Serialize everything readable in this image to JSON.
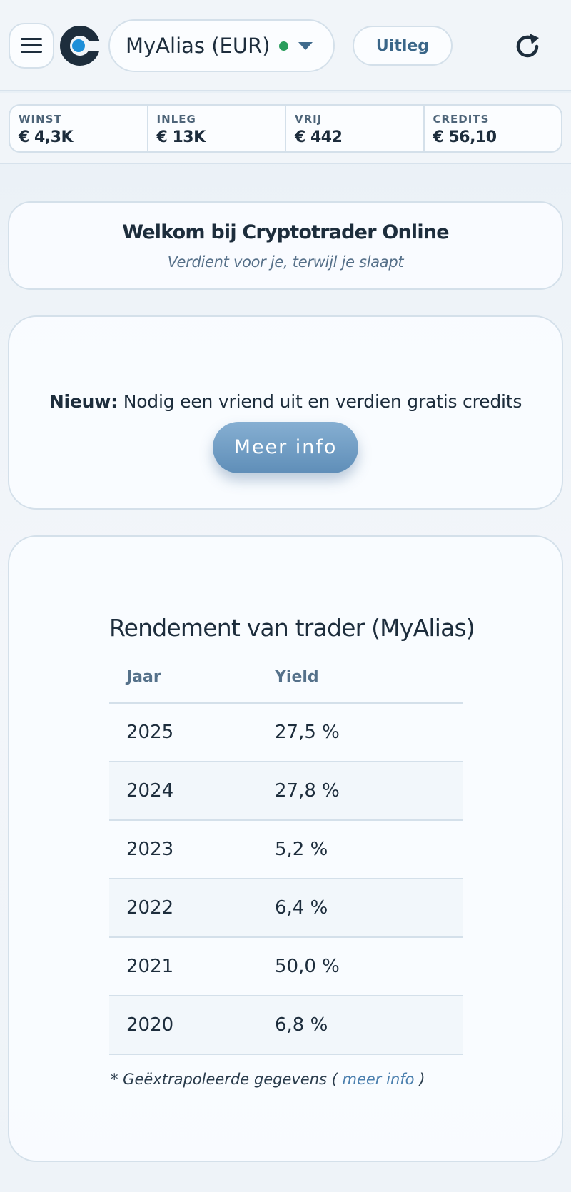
{
  "header": {
    "account_name": "MyAlias (EUR)",
    "status_color": "#2a9d5c",
    "explain_label": "Uitleg",
    "icons": [
      "menu-icon",
      "logo-icon",
      "chevron-down-icon",
      "refresh-icon"
    ]
  },
  "stats": [
    {
      "label": "WINST",
      "value": "€ 4,3K"
    },
    {
      "label": "INLEG",
      "value": "€ 13K"
    },
    {
      "label": "VRIJ",
      "value": "€ 442"
    },
    {
      "label": "CREDITS",
      "value": "€ 56,10"
    }
  ],
  "welcome": {
    "title": "Welkom bij Cryptotrader Online",
    "subtitle": "Verdient voor je, terwijl je slaapt"
  },
  "invite": {
    "prefix": "Nieuw:",
    "text": " Nodig een vriend uit en verdien gratis credits",
    "button_label": "Meer info"
  },
  "yield_table": {
    "title": "Rendement van trader (MyAlias)",
    "headers": [
      "Jaar",
      "Yield"
    ],
    "rows": [
      [
        "2025",
        "27,5 %"
      ],
      [
        "2024",
        "27,8 %"
      ],
      [
        "2023",
        "5,2 %"
      ],
      [
        "2022",
        "6,4 %"
      ],
      [
        "2021",
        "50,0 %"
      ],
      [
        "2020",
        "6,8 %"
      ]
    ],
    "footnote_prefix": "* Geëxtrapoleerde gegevens ( ",
    "footnote_link": "meer info",
    "footnote_suffix": " )"
  },
  "colors": {
    "brand_dark": "#1d2d3c",
    "brand_blue": "#1d8fd8",
    "accent": "#5f8eb8"
  }
}
